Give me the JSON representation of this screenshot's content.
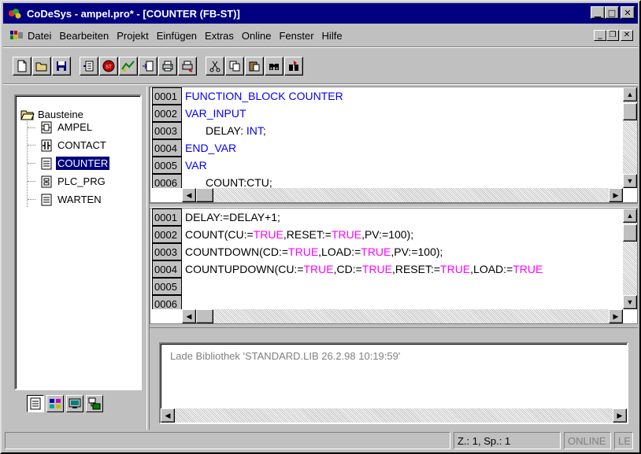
{
  "window": {
    "title": "CoDeSys - ampel.pro* - [COUNTER (FB-ST)]"
  },
  "menu": [
    {
      "label": "Datei"
    },
    {
      "label": "Bearbeiten"
    },
    {
      "label": "Projekt"
    },
    {
      "label": "Einfügen"
    },
    {
      "label": "Extras"
    },
    {
      "label": "Online"
    },
    {
      "label": "Fenster"
    },
    {
      "label": "Hilfe"
    }
  ],
  "tree": {
    "root": "Bausteine",
    "items": [
      {
        "label": "AMPEL",
        "icon": "function-block-icon"
      },
      {
        "label": "CONTACT",
        "icon": "function-icon"
      },
      {
        "label": "COUNTER",
        "icon": "document-icon",
        "selected": true
      },
      {
        "label": "PLC_PRG",
        "icon": "program-icon"
      },
      {
        "label": "WARTEN",
        "icon": "document-icon"
      }
    ]
  },
  "declaration": {
    "lines": [
      {
        "num": "0001",
        "text": "FUNCTION_BLOCK COUNTER"
      },
      {
        "num": "0002",
        "text": "VAR_INPUT"
      },
      {
        "num": "0003",
        "text": "DELAY: INT;"
      },
      {
        "num": "0004",
        "text": "END_VAR"
      },
      {
        "num": "0005",
        "text": "VAR"
      },
      {
        "num": "0006",
        "text": "COUNT:CTU;"
      }
    ]
  },
  "body": {
    "lines": [
      {
        "num": "0001",
        "text": "DELAY:=DELAY+1;"
      },
      {
        "num": "0002",
        "text": "COUNT(CU:=TRUE,RESET:=TRUE,PV:=100);"
      },
      {
        "num": "0003",
        "text": "COUNTDOWN(CD:=TRUE,LOAD:=TRUE,PV:=100);"
      },
      {
        "num": "0004",
        "text": "COUNTUPDOWN(CU:=TRUE,CD:=TRUE,RESET:=TRUE,LOAD:=TRUE"
      },
      {
        "num": "0005",
        "text": ""
      },
      {
        "num": "0006",
        "text": ""
      }
    ]
  },
  "messages": {
    "text": "Lade Bibliothek 'STANDARD.LIB 26.2.98 10:19:59'"
  },
  "status": {
    "position": "Z.: 1, Sp.: 1",
    "online": "ONLINE",
    "extra": "LE"
  },
  "colors": {
    "keyword": "#0000ff",
    "boolean": "#ff00ff",
    "titlebar": "#000080"
  }
}
